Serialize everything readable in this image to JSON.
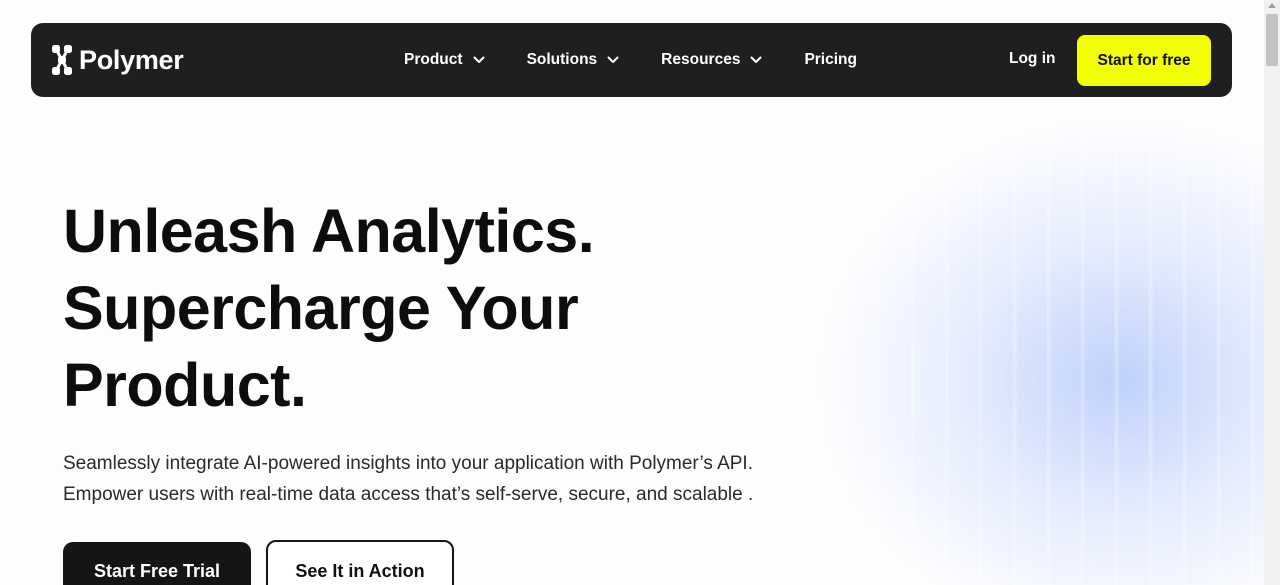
{
  "brand": {
    "name": "Polymer",
    "logo_icon": "polymer-logo-icon"
  },
  "nav": {
    "items": [
      {
        "label": "Product",
        "has_dropdown": true
      },
      {
        "label": "Solutions",
        "has_dropdown": true
      },
      {
        "label": "Resources",
        "has_dropdown": true
      },
      {
        "label": "Pricing",
        "has_dropdown": false
      }
    ],
    "login_label": "Log in",
    "cta_label": "Start for free"
  },
  "hero": {
    "headline_lines": [
      "Unleash Analytics.",
      "Supercharge Your",
      "Product."
    ],
    "subtext_lines": [
      "Seamlessly integrate AI-powered insights into your application with Polymer’s API.",
      "Empower users with real-time data access that’s self-serve, secure, and scalable ."
    ],
    "primary_button": "Start Free Trial",
    "secondary_button": "See It in Action"
  },
  "colors": {
    "navbar_bg": "#1f1f1f",
    "cta_bg": "#f2ff00",
    "primary_button_bg": "#151515",
    "glow": "#aac3fa"
  }
}
